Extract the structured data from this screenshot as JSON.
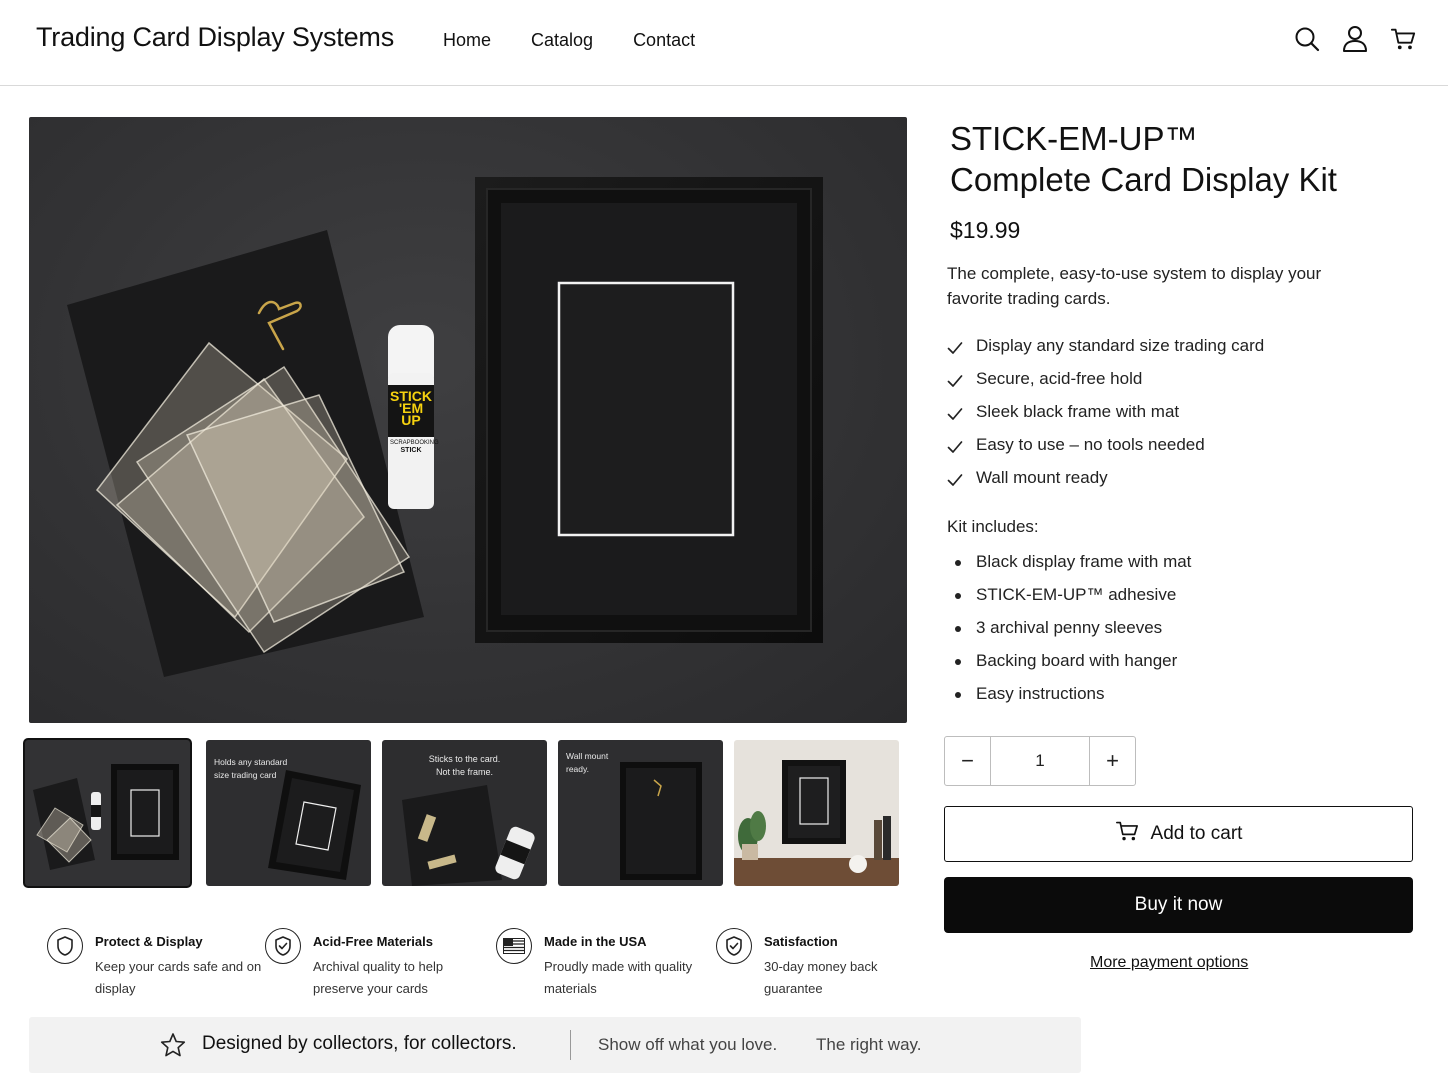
{
  "header": {
    "brand": "Trading Card Display Systems",
    "nav": [
      "Home",
      "Catalog",
      "Contact"
    ],
    "icons": [
      "search-icon",
      "account-icon",
      "cart-icon"
    ]
  },
  "gallery": {
    "main_glue_label_1": "STICK",
    "main_glue_label_2": "'EM",
    "main_glue_label_3": "UP",
    "main_glue_label_4": "SCRAPBOOKING",
    "main_glue_label_5": "STICK",
    "thumbnails": [
      {
        "caption_1": "",
        "caption_2": ""
      },
      {
        "caption_1": "Holds any standard",
        "caption_2": "size trading card"
      },
      {
        "caption_1": "Sticks to the card.",
        "caption_2": "Not the frame."
      },
      {
        "caption_1": "Wall mount",
        "caption_2": "ready."
      },
      {
        "caption_1": "",
        "caption_2": ""
      }
    ]
  },
  "features": [
    {
      "icon": "shield-icon",
      "title": "Protect & Display",
      "desc": "Keep your cards safe and on display"
    },
    {
      "icon": "shield-check-icon",
      "title": "Acid-Free Materials",
      "desc": "Archival quality to help preserve your cards"
    },
    {
      "icon": "flag-icon",
      "title": "Made in the USA",
      "desc": "Proudly made with quality materials"
    },
    {
      "icon": "shield-check-icon",
      "title": "Satisfaction",
      "desc": "30-day money back guarantee"
    }
  ],
  "banner": {
    "tagline": "Designed by collectors, for collectors.",
    "sub1": "Show off what you love.",
    "sub2": "The right way."
  },
  "product": {
    "title_line1": "STICK-EM-UP™",
    "title_line2": "Complete Card Display Kit",
    "price": "$19.99",
    "description": "The complete, easy-to-use system to display your favorite trading cards.",
    "benefits": [
      "Display any standard size trading card",
      "Secure, acid-free hold",
      "Sleek black frame with mat",
      "Easy to use – no tools needed",
      "Wall mount ready"
    ],
    "kit_label": "Kit includes:",
    "kit_items": [
      "Black display frame with mat",
      "STICK-EM-UP™ adhesive",
      "3 archival penny sleeves",
      "Backing board with hanger",
      "Easy instructions"
    ],
    "quantity": "1",
    "minus": "−",
    "plus": "+",
    "add_to_cart": "Add to cart",
    "buy_now": "Buy it now",
    "more_payment": "More payment options"
  }
}
